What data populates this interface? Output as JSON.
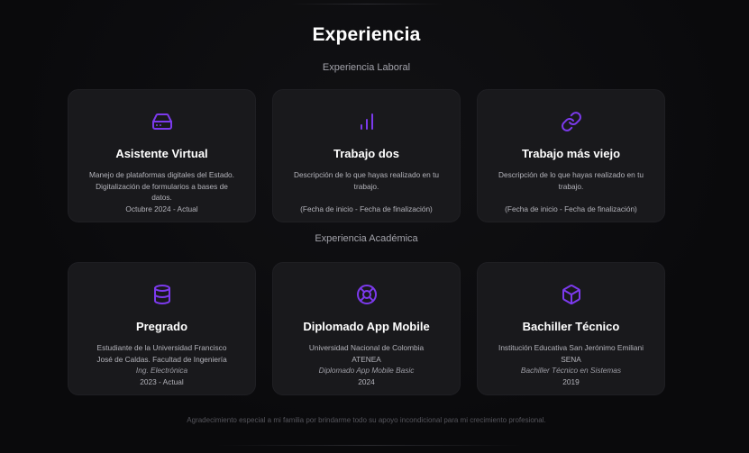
{
  "header": {
    "title": "Experiencia",
    "work_section_label": "Experiencia Laboral",
    "academic_section_label": "Experiencia Académica"
  },
  "work_cards": [
    {
      "icon": "hard-drive-icon",
      "title": "Asistente Virtual",
      "lines": [
        "Manejo de plataformas digitales del Estado.",
        "Digitalización de formularios a bases de",
        "datos."
      ],
      "date": "Octubre 2024 - Actual"
    },
    {
      "icon": "bar-chart-icon",
      "title": "Trabajo dos",
      "lines": [
        "Descripción de lo que hayas realizado en tu",
        "trabajo."
      ],
      "date": "(Fecha de inicio - Fecha de finalización)"
    },
    {
      "icon": "link-icon",
      "title": "Trabajo más viejo",
      "lines": [
        "Descripción de lo que hayas realizado en tu",
        "trabajo."
      ],
      "date": "(Fecha de inicio - Fecha de finalización)"
    }
  ],
  "academic_cards": [
    {
      "icon": "database-icon",
      "title": "Pregrado",
      "lines": [
        "Estudiante de la Universidad Francisco",
        "José de Caldas. Facultad de Ingeniería"
      ],
      "degree": "Ing. Electrónica",
      "date": "2023 - Actual"
    },
    {
      "icon": "life-buoy-icon",
      "title": "Diplomado App Mobile",
      "lines": [
        "Universidad Nacional de Colombia",
        "ATENEA"
      ],
      "degree": "Diplomado App Mobile Basic",
      "date": "2024"
    },
    {
      "icon": "box-icon",
      "title": "Bachiller Técnico",
      "lines": [
        "Institución Educativa San Jerónimo Emiliani",
        "SENA"
      ],
      "degree": "Bachiller Técnico en Sistemas",
      "date": "2019"
    }
  ],
  "footer": {
    "note": "Agradecimiento especial a mi familia por brindarme todo su apoyo incondicional para mi crecimiento profesional."
  },
  "colors": {
    "accent": "#7c3aed",
    "card_bg": "#19191c",
    "page_bg": "#0b0b0d"
  }
}
